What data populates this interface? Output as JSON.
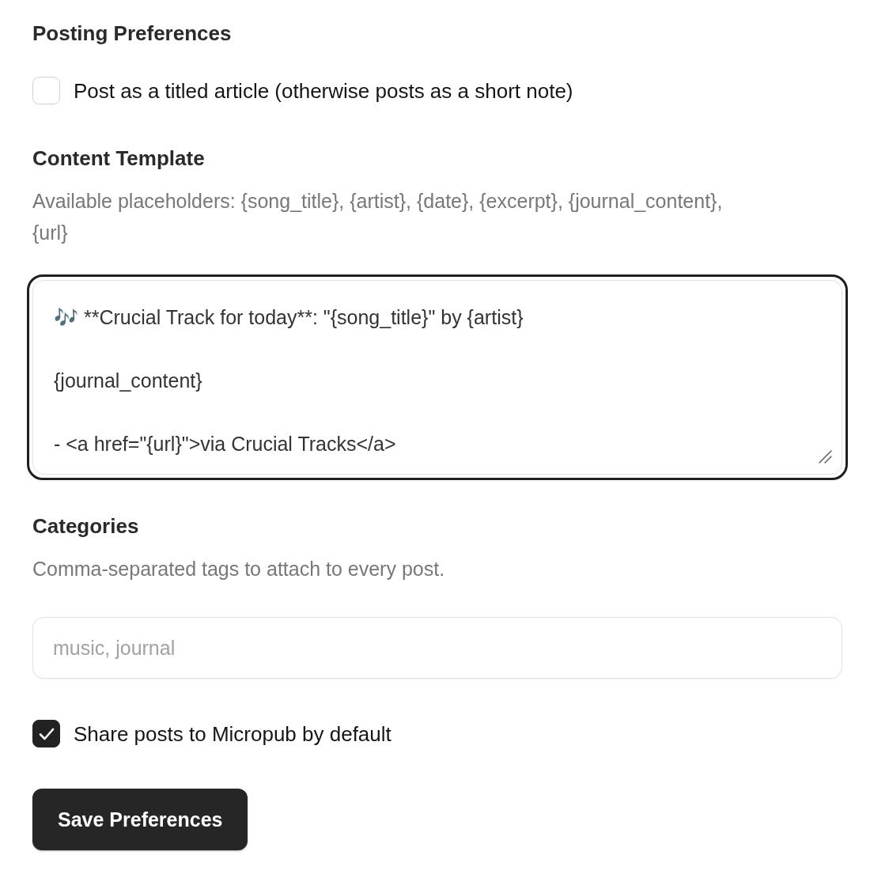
{
  "heading": "Posting Preferences",
  "article_option": {
    "label": "Post as a titled article (otherwise posts as a short note)",
    "checked": false
  },
  "content_template": {
    "label": "Content Template",
    "help": "Available placeholders: {song_title}, {artist}, {date}, {excerpt}, {journal_content}, {url}",
    "value": "🎶 **Crucial Track for today**: \"{song_title}\" by {artist}\n\n{journal_content}\n\n- <a href=\"{url}\">via Crucial Tracks</a>",
    "focused": true
  },
  "categories": {
    "label": "Categories",
    "help": "Comma-separated tags to attach to every post.",
    "placeholder": "music, journal"
  },
  "micropub_option": {
    "label": "Share posts to Micropub by default",
    "checked": true
  },
  "save_button": {
    "label": "Save Preferences"
  }
}
